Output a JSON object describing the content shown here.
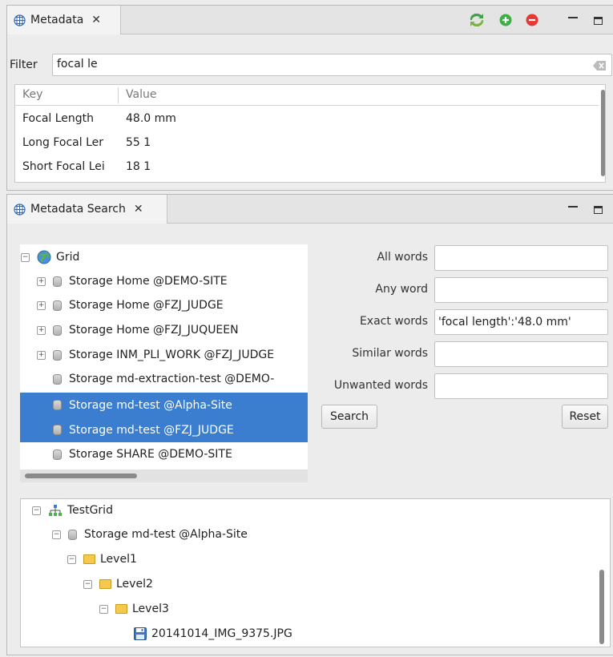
{
  "metadata_view": {
    "tab_title": "Metadata",
    "filter_label": "Filter",
    "filter_value": "focal le",
    "columns": [
      "Key",
      "Value"
    ],
    "rows": [
      {
        "key": "Focal Length",
        "value": "48.0 mm"
      },
      {
        "key": "Long Focal Ler",
        "value": "55 1"
      },
      {
        "key": "Short Focal Lei",
        "value": "18 1"
      }
    ]
  },
  "search_view": {
    "tab_title": "Metadata Search",
    "grid_tree": {
      "root": "Grid",
      "items": [
        "Storage Home @DEMO-SITE",
        "Storage Home @FZJ_JUDGE",
        "Storage Home @FZJ_JUQUEEN",
        "Storage INM_PLI_WORK @FZJ_JUDGE",
        "Storage md-extraction-test @DEMO-",
        "Storage md-test @Alpha-Site",
        "Storage md-test @FZJ_JUDGE",
        "Storage SHARE @DEMO-SITE"
      ]
    },
    "form": {
      "all_words_label": "All words",
      "any_word_label": "Any word",
      "exact_words_label": "Exact words",
      "exact_words_value": "'focal length':'48.0 mm'",
      "similar_words_label": "Similar words",
      "unwanted_words_label": "Unwanted words",
      "search_button": "Search",
      "reset_button": "Reset"
    },
    "results_tree": {
      "root": "TestGrid",
      "storage": "Storage md-test @Alpha-Site",
      "level1": "Level1",
      "level2": "Level2",
      "level3": "Level3",
      "file": "20141014_IMG_9375.JPG"
    }
  },
  "colors": {
    "selection": "#3b7dce",
    "refresh_icon": "#43a047",
    "add_icon": "#3cb043",
    "remove_icon": "#e53935"
  }
}
